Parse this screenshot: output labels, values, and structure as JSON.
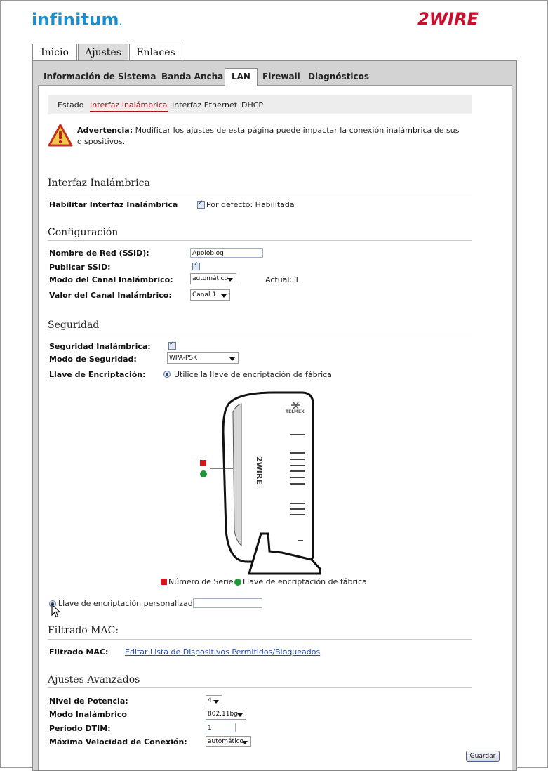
{
  "header": {
    "brand_left": "infinitum",
    "brand_right": "2WIRE"
  },
  "main_tabs": [
    {
      "label": "Inicio"
    },
    {
      "label": "Ajustes"
    },
    {
      "label": "Enlaces"
    }
  ],
  "sub_tabs": [
    {
      "label": "Información de Sistema"
    },
    {
      "label": "Banda Ancha"
    },
    {
      "label": "LAN"
    },
    {
      "label": "Firewall"
    },
    {
      "label": "Diagnósticos"
    }
  ],
  "third_nav": [
    {
      "label": "Estado"
    },
    {
      "label": "Interfaz Inalámbrica"
    },
    {
      "label": "Interfaz Ethernet"
    },
    {
      "label": "DHCP"
    }
  ],
  "warning": {
    "title": "Advertencia:",
    "text": "Modificar los ajustes de esta página puede impactar la conexión inalámbrica de sus dispositivos."
  },
  "wireless_interface": {
    "section_title": "Interfaz Inalámbrica",
    "enable_label": "Habilitar Interfaz Inalámbrica",
    "enable_checked": true,
    "default_text": "Por defecto: Habilitada"
  },
  "configuration": {
    "section_title": "Configuración",
    "ssid_label": "Nombre de Red (SSID):",
    "ssid_value": "Apoloblog",
    "publish_label": "Publicar SSID:",
    "publish_checked": true,
    "channel_mode_label": "Modo del Canal Inalámbrico:",
    "channel_mode_value": "automático",
    "current_channel": "Actual: 1",
    "channel_value_label": "Valor del Canal Inalámbrico:",
    "channel_value": "Canal 1"
  },
  "security": {
    "section_title": "Seguridad",
    "wireless_security_label": "Seguridad Inalámbrica:",
    "wireless_security_checked": true,
    "mode_label": "Modo de Seguridad:",
    "mode_value": "WPA-PSK",
    "key_label": "Llave de Encriptación:",
    "factory_key_option": "Utilice la llave de encriptación de fábrica",
    "legend_serial": "Número de Serie",
    "legend_factory_key": "Llave de encriptación de fábrica",
    "custom_key_option": "Llave de encriptación personalizada:",
    "custom_key_value": "",
    "device_labels": {
      "telmex": "TELMEX",
      "brand": "2WIRE"
    },
    "colors": {
      "serial": "#d4161e",
      "key": "#1f9a3a"
    }
  },
  "mac_filter": {
    "section_title": "Filtrado MAC:",
    "label": "Filtrado MAC:",
    "link": "Editar Lista de Dispositivos Permitidos/Bloqueados"
  },
  "advanced": {
    "section_title": "Ajustes Avanzados",
    "power_label": "Nivel de Potencia:",
    "power_value": "4",
    "mode_label": "Modo Inalámbrico",
    "mode_value": "802.11bg",
    "dtim_label": "Periodo DTIM:",
    "dtim_value": "1",
    "speed_label": "Máxima Velocidad de Conexión:",
    "speed_value": "automático",
    "save_label": "Guardar"
  }
}
